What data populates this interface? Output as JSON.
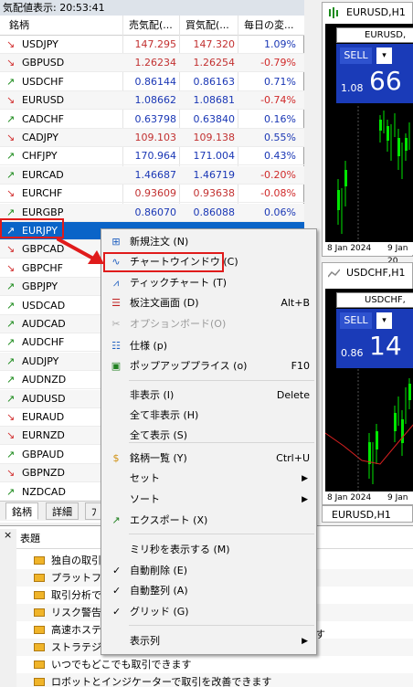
{
  "market_watch": {
    "title": "気配値表示: 20:53:41",
    "headers": {
      "symbol": "銘柄",
      "bid": "売気配(...",
      "ask": "買気配(...",
      "change": "毎日の変..."
    },
    "rows": [
      {
        "dir": "down",
        "symbol": "USDJPY",
        "bid": "147.295",
        "ask": "147.320",
        "change": "1.09%",
        "price_color": "red",
        "change_color": "blue"
      },
      {
        "dir": "down",
        "symbol": "GBPUSD",
        "bid": "1.26234",
        "ask": "1.26254",
        "change": "-0.79%",
        "price_color": "red",
        "change_color": "red"
      },
      {
        "dir": "up",
        "symbol": "USDCHF",
        "bid": "0.86144",
        "ask": "0.86163",
        "change": "0.71%",
        "price_color": "blue",
        "change_color": "blue"
      },
      {
        "dir": "down",
        "symbol": "EURUSD",
        "bid": "1.08662",
        "ask": "1.08681",
        "change": "-0.74%",
        "price_color": "blue",
        "change_color": "red"
      },
      {
        "dir": "up",
        "symbol": "CADCHF",
        "bid": "0.63798",
        "ask": "0.63840",
        "change": "0.16%",
        "price_color": "blue",
        "change_color": "blue"
      },
      {
        "dir": "down",
        "symbol": "CADJPY",
        "bid": "109.103",
        "ask": "109.138",
        "change": "0.55%",
        "price_color": "red",
        "change_color": "blue"
      },
      {
        "dir": "up",
        "symbol": "CHFJPY",
        "bid": "170.964",
        "ask": "171.004",
        "change": "0.43%",
        "price_color": "blue",
        "change_color": "blue"
      },
      {
        "dir": "up",
        "symbol": "EURCAD",
        "bid": "1.46687",
        "ask": "1.46719",
        "change": "-0.20%",
        "price_color": "blue",
        "change_color": "red"
      },
      {
        "dir": "down",
        "symbol": "EURCHF",
        "bid": "0.93609",
        "ask": "0.93638",
        "change": "-0.08%",
        "price_color": "red",
        "change_color": "red"
      },
      {
        "dir": "up",
        "symbol": "EURGBP",
        "bid": "0.86070",
        "ask": "0.86088",
        "change": "0.06%",
        "price_color": "blue",
        "change_color": "blue"
      },
      {
        "dir": "up",
        "symbol": "EURJPY",
        "bid": "",
        "ask": "",
        "change": "",
        "price_color": "blue",
        "change_color": "blue",
        "selected": true
      },
      {
        "dir": "down",
        "symbol": "GBPCAD"
      },
      {
        "dir": "down",
        "symbol": "GBPCHF"
      },
      {
        "dir": "up",
        "symbol": "GBPJPY"
      },
      {
        "dir": "up",
        "symbol": "USDCAD"
      },
      {
        "dir": "up",
        "symbol": "AUDCAD"
      },
      {
        "dir": "up",
        "symbol": "AUDCHF"
      },
      {
        "dir": "up",
        "symbol": "AUDJPY"
      },
      {
        "dir": "up",
        "symbol": "AUDNZD"
      },
      {
        "dir": "up",
        "symbol": "AUDUSD"
      },
      {
        "dir": "down",
        "symbol": "EURAUD"
      },
      {
        "dir": "down",
        "symbol": "EURNZD"
      },
      {
        "dir": "up",
        "symbol": "GBPAUD"
      },
      {
        "dir": "down",
        "symbol": "GBPNZD"
      },
      {
        "dir": "up",
        "symbol": "NZDCAD"
      }
    ],
    "tabs": [
      "銘柄",
      "詳細",
      "ﾌ"
    ]
  },
  "charts": [
    {
      "title": "EURUSD,H1",
      "mini_title": "EURUSD,",
      "sell": "SELL",
      "small": "1.08",
      "big": "66",
      "date1": "8 Jan 2024",
      "date2": "9 Jan 20"
    },
    {
      "title": "USDCHF,H1",
      "mini_title": "USDCHF,",
      "sell": "SELL",
      "small": "0.86",
      "big": "14",
      "date1": "8 Jan 2024",
      "date2": "9 Jan 20"
    }
  ],
  "chart_tab": "EURUSD,H1",
  "news": {
    "header": "表題",
    "close": "×",
    "items": [
      "独自の取引",
      "プラットフォー",
      "取引分析で",
      "リスク警告",
      "高速ホスティ",
      "ストラテジー",
      "いつでもどこでも取引できます",
      "ロボットとインジケーターで取引を改善できます"
    ],
    "trailing_glyph": "す"
  },
  "context_menu": {
    "items": [
      {
        "label": "新規注文 (N)",
        "shortcut": "",
        "icon": "plus-order-icon"
      },
      {
        "label": "チャートウインドウ (C)",
        "shortcut": "",
        "icon": "chart-line-icon"
      },
      {
        "label": "ティックチャート (T)",
        "shortcut": "",
        "icon": "tick-chart-icon"
      },
      {
        "label": "板注文画面 (D)",
        "shortcut": "Alt+B",
        "icon": "depth-of-market-icon"
      },
      {
        "label": "オプションボード(O)",
        "shortcut": "",
        "icon": "options-board-icon",
        "disabled": true
      },
      {
        "label": "仕様 (p)",
        "shortcut": "",
        "icon": "specification-icon"
      },
      {
        "label": "ポップアッププライス (o)",
        "shortcut": "F10",
        "icon": "popup-prices-icon"
      },
      {
        "label": "非表示 (I)",
        "shortcut": "Delete"
      },
      {
        "label": "全て非表示 (H)",
        "shortcut": ""
      },
      {
        "label": "全て表示 (S)",
        "shortcut": ""
      },
      {
        "label": "銘柄一覧 (Y)",
        "shortcut": "Ctrl+U",
        "icon": "symbols-icon"
      },
      {
        "label": "セット",
        "shortcut": "",
        "submenu": true
      },
      {
        "label": "ソート",
        "shortcut": "",
        "submenu": true
      },
      {
        "label": "エクスポート (X)",
        "shortcut": "",
        "icon": "export-icon"
      },
      {
        "label": "ミリ秒を表示する (M)",
        "shortcut": ""
      },
      {
        "label": "自動削除 (E)",
        "shortcut": "",
        "checked": true
      },
      {
        "label": "自動整列 (A)",
        "shortcut": "",
        "checked": true
      },
      {
        "label": "グリッド (G)",
        "shortcut": "",
        "checked": true
      },
      {
        "label": "表示列",
        "shortcut": "",
        "submenu": true
      }
    ]
  },
  "colors": {
    "selection": "#0a64c8",
    "highlight": "#e01b1b",
    "trade_panel": "#1a3bb8",
    "up_arrow": "#1b8a1b",
    "down_arrow": "#d23030"
  }
}
